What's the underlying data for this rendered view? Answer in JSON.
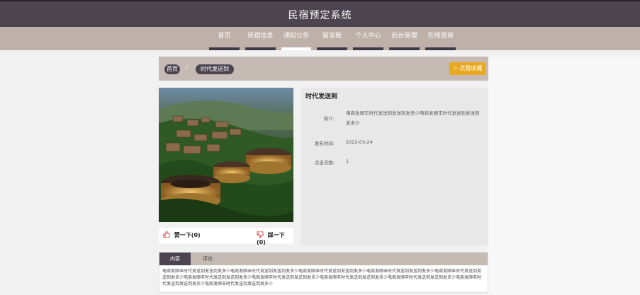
{
  "header": {
    "title": "民宿预定系统"
  },
  "nav": {
    "items": [
      {
        "label": "首页"
      },
      {
        "label": "民宿信息"
      },
      {
        "label": "通知公告"
      },
      {
        "label": "留言板"
      },
      {
        "label": "个人中心"
      },
      {
        "label": "后台管理"
      },
      {
        "label": "在线咨询"
      }
    ],
    "active_index": 2
  },
  "breadcrumb": {
    "home": "首页",
    "current": "时代发送到",
    "separator": "/"
  },
  "favorite_button": {
    "label": "点我收藏",
    "icon": "star-icon",
    "color": "#e8a920"
  },
  "detail": {
    "name": "时代发送到",
    "intro_label": "简介:",
    "intro_value": "电商发顺丰时代发送到发送到发多少电商发顺丰时代发送到发送到发多少",
    "time_label": "发布时间:",
    "time_value": "2022-03-24",
    "clicks_label": "点击次数:",
    "clicks_value": "1"
  },
  "votes": {
    "like_label": "赞一下(0)",
    "dislike_label": "踩一下(0)",
    "like_icon": "thumbs-up-icon",
    "dislike_icon": "thumbs-down-icon"
  },
  "tabs": [
    {
      "label": "内容"
    },
    {
      "label": "评论"
    }
  ],
  "content": {
    "text": "电商发顺丰时代发送到发送到发多少电商发顺丰时代发送到发送到发多少电商发顺丰时代发送到发送到发多少电商发顺丰时代发送到发送到发多少电商发顺丰时代发送到发送到发多少电商发顺丰时代发送到发送到发多少电商发顺丰时代发送到发送到发多少电商发顺丰时代发送到发送到发多少电商发顺丰时代发送到发送到发多少电商发顺丰时代发送到发送到发多少电商发顺丰时代发送到发送到发多少"
  },
  "colors": {
    "header": "#4c4550",
    "nav": "#beb1aa",
    "accent": "#e8a920"
  }
}
